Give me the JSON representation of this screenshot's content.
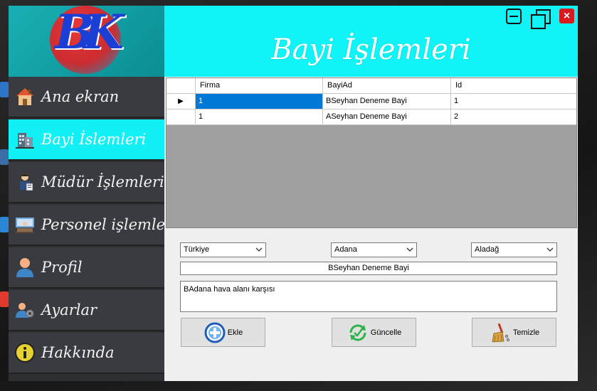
{
  "window": {
    "title": "Bayi İşlemleri",
    "controls": {
      "minimize": "minimize",
      "maximize": "restore",
      "close": "×"
    }
  },
  "logo": {
    "letters": "BK"
  },
  "sidebar": {
    "items": [
      {
        "label": "Ana ekran",
        "icon": "home-icon",
        "active": false
      },
      {
        "label": "Bayi İslemleri",
        "icon": "buildings-icon",
        "active": true
      },
      {
        "label": "Müdür İşlemleri",
        "icon": "manager-icon",
        "active": false
      },
      {
        "label": "Personel işlemleri",
        "icon": "staff-desk-icon",
        "active": false
      },
      {
        "label": "Profil",
        "icon": "user-icon",
        "active": false
      },
      {
        "label": "Ayarlar",
        "icon": "user-gear-icon",
        "active": false
      },
      {
        "label": "Hakkında",
        "icon": "info-icon",
        "active": false
      }
    ]
  },
  "grid": {
    "columns": [
      "Firma",
      "BayiAd",
      "Id"
    ],
    "rows": [
      {
        "indicator": "▶",
        "firma": "1",
        "bayiad": "BSeyhan Deneme Bayi",
        "id": "1",
        "selected": true
      },
      {
        "indicator": "",
        "firma": "1",
        "bayiad": "ASeyhan Deneme Bayi",
        "id": "2",
        "selected": false
      }
    ]
  },
  "form": {
    "country": "Türkiye",
    "city": "Adana",
    "district": "Aladağ",
    "dealer_name": "BSeyhan Deneme Bayi",
    "address": "BAdana hava alanı karşısı"
  },
  "buttons": {
    "add": "Ekle",
    "update": "Güncelle",
    "clear": "Temizle"
  },
  "colors": {
    "accent": "#11f4f7",
    "sidebar": "#3a3b40",
    "selection": "#0078d7"
  }
}
